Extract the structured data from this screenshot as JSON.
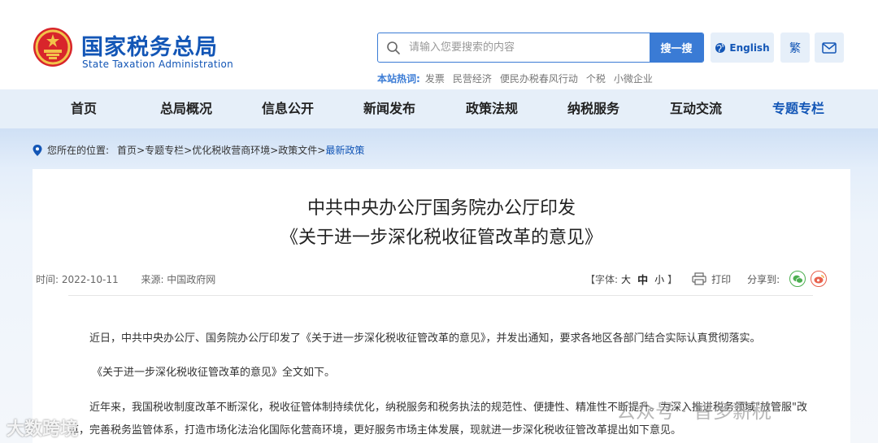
{
  "header": {
    "brand_cn": "国家税务总局",
    "brand_en": "State Taxation Administration",
    "search_placeholder": "请输入您要搜索的内容",
    "search_button": "搜一搜",
    "lang_button": "English",
    "trad_button": "繁",
    "hot_label": "本站热词:",
    "hot_words": [
      "发票",
      "民营经济",
      "便民办税春风行动",
      "个税",
      "小微企业"
    ]
  },
  "nav": {
    "items": [
      "首页",
      "总局概况",
      "信息公开",
      "新闻发布",
      "政策法规",
      "纳税服务",
      "互动交流",
      "专题专栏"
    ],
    "active_index": 7
  },
  "breadcrumb": {
    "label": "您所在的位置:",
    "path": [
      "首页",
      "专题专栏",
      "优化税收营商环境",
      "政策文件"
    ],
    "current": "最新政策",
    "separator": ">"
  },
  "article": {
    "title_line1": "中共中央办公厅国务院办公厅印发",
    "title_line2": "《关于进一步深化税收征管改革的意见》",
    "date_text": "时间:  2022-10-11",
    "source_text": "来源:  中国政府网",
    "font_label": "【字体:",
    "font_large": "大",
    "font_mid": "中",
    "font_small": "小",
    "font_close": "】",
    "print_label": "打印",
    "share_label": "分享到:",
    "paragraphs": [
      "近日，中共中央办公厅、国务院办公厅印发了《关于进一步深化税收征管改革的意见》，并发出通知，要求各地区各部门结合实际认真贯彻落实。",
      "《关于进一步深化税收征管改革的意见》全文如下。",
      "近年来，我国税收制度改革不断深化，税收征管体制持续优化，纳税服务和税务执法的规范性、便捷性、精准性不断提升。为深入推进税务领域\"放管服\"改",
      "革，完善税务监管体系，打造市场化法治化国际化营商环境，更好服务市场主体发展，现就进一步深化税收征管改革提出如下意见。"
    ]
  },
  "watermark": {
    "right": "公众号 · 智多薪税",
    "left": "大数跨境"
  },
  "colors": {
    "brand": "#1356b6",
    "accent": "#3a7bd5",
    "nav_bg": "#e6eff9"
  }
}
